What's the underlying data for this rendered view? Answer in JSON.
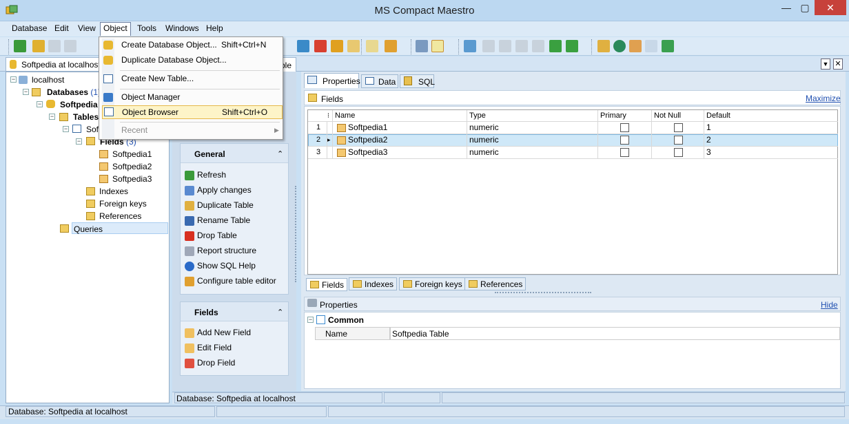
{
  "window": {
    "title": "MS Compact Maestro",
    "minimize": "—",
    "maximize": "▢",
    "close": "✕"
  },
  "menubar": [
    "Database",
    "Edit",
    "View",
    "Object",
    "Tools",
    "Windows",
    "Help"
  ],
  "object_menu": [
    {
      "label": "Create Database Object...",
      "shortcut": "Shift+Ctrl+N"
    },
    {
      "label": "Duplicate Database Object...",
      "shortcut": ""
    },
    {
      "label": "Create New Table...",
      "shortcut": ""
    },
    {
      "label": "Object Manager",
      "shortcut": ""
    },
    {
      "label": "Object Browser",
      "shortcut": "Shift+Ctrl+O"
    },
    {
      "label": "Recent",
      "shortcut": ""
    }
  ],
  "doc_tab": {
    "label": "Softpedia at localhost",
    "partial_tab": "ble"
  },
  "tree": {
    "localhost": "localhost",
    "databases": "Databases",
    "databases_count": "(1)",
    "softpedia": "Softpedia",
    "tables": "Tables",
    "softpedia_table": "Softpedia Table",
    "fields": "Fields",
    "fields_count": "(3)",
    "field1": "Softpedia1",
    "field2": "Softpedia2",
    "field3": "Softpedia3",
    "indexes": "Indexes",
    "foreign_keys": "Foreign keys",
    "references": "References",
    "queries": "Queries"
  },
  "nav_general": {
    "title": "General",
    "items": [
      "Refresh",
      "Apply changes",
      "Duplicate Table",
      "Rename Table",
      "Drop Table",
      "Report structure",
      "Show SQL Help",
      "Configure table editor"
    ]
  },
  "nav_fields": {
    "title": "Fields",
    "items": [
      "Add New Field",
      "Edit Field",
      "Drop Field"
    ]
  },
  "editor_tabs": [
    "Properties",
    "Data",
    "SQL"
  ],
  "fields_panel": {
    "title": "Fields",
    "maximize": "Maximize"
  },
  "grid": {
    "columns": [
      "Name",
      "Type",
      "Primary",
      "Not Null",
      "Default"
    ],
    "rows": [
      {
        "num": "1",
        "name": "Softpedia1",
        "type": "numeric",
        "default": "1"
      },
      {
        "num": "2",
        "name": "Softpedia2",
        "type": "numeric",
        "default": "2"
      },
      {
        "num": "3",
        "name": "Softpedia3",
        "type": "numeric",
        "default": "3"
      }
    ]
  },
  "bottom_tabs": [
    "Fields",
    "Indexes",
    "Foreign keys",
    "References"
  ],
  "properties_panel": {
    "title": "Properties",
    "hide": "Hide",
    "group": "Common",
    "prop_name": "Name",
    "prop_value": "Softpedia Table"
  },
  "status": {
    "inner": "Database: Softpedia at localhost",
    "main": "Database: Softpedia at localhost"
  }
}
